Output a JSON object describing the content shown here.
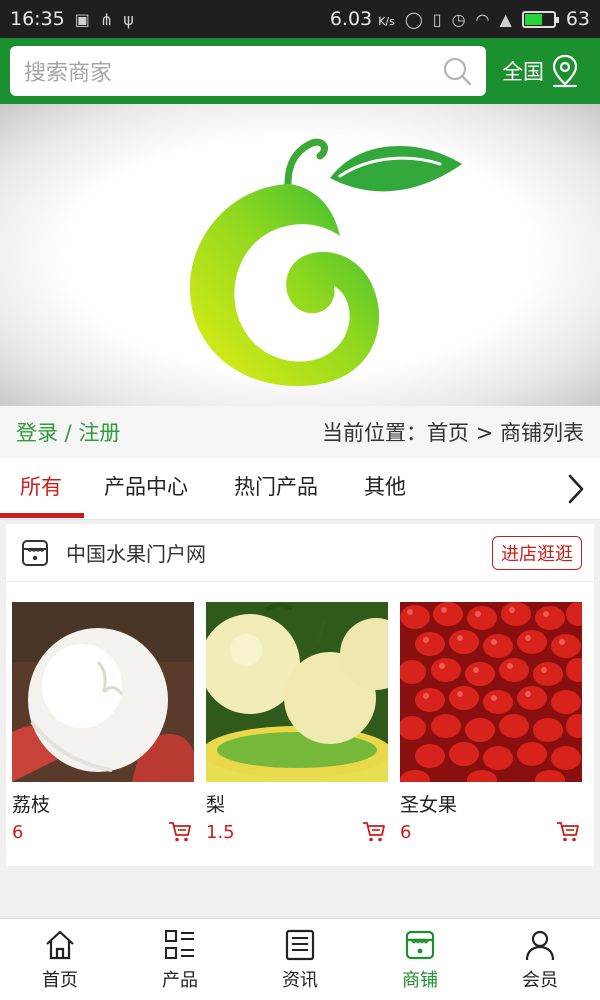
{
  "status_bar": {
    "time": "16:35",
    "net_speed": "6.03",
    "net_unit": "K/s",
    "battery": "63"
  },
  "header": {
    "search_placeholder": "搜索商家",
    "region_label": "全国"
  },
  "crumb_bar": {
    "login_label": "登录 / 注册",
    "location": "当前位置：首页 > 商铺列表"
  },
  "tabs": [
    {
      "label": "所有",
      "active": true
    },
    {
      "label": "产品中心",
      "active": false
    },
    {
      "label": "热门产品",
      "active": false
    },
    {
      "label": "其他",
      "active": false
    }
  ],
  "store": {
    "name": "中国水果门户网",
    "visit_label": "进店逛逛",
    "products": [
      {
        "name": "荔枝",
        "price": "6"
      },
      {
        "name": "梨",
        "price": "1.5"
      },
      {
        "name": "圣女果",
        "price": "6"
      }
    ]
  },
  "bottom_nav": [
    {
      "label": "首页",
      "icon": "home-icon"
    },
    {
      "label": "产品",
      "icon": "list-icon"
    },
    {
      "label": "资讯",
      "icon": "news-icon"
    },
    {
      "label": "商铺",
      "icon": "shop-icon",
      "active": true
    },
    {
      "label": "会员",
      "icon": "user-icon"
    }
  ],
  "colors": {
    "brand_green": "#1c8f2e",
    "accent_red": "#cc1d1d",
    "login_green": "#2f9c3c"
  }
}
